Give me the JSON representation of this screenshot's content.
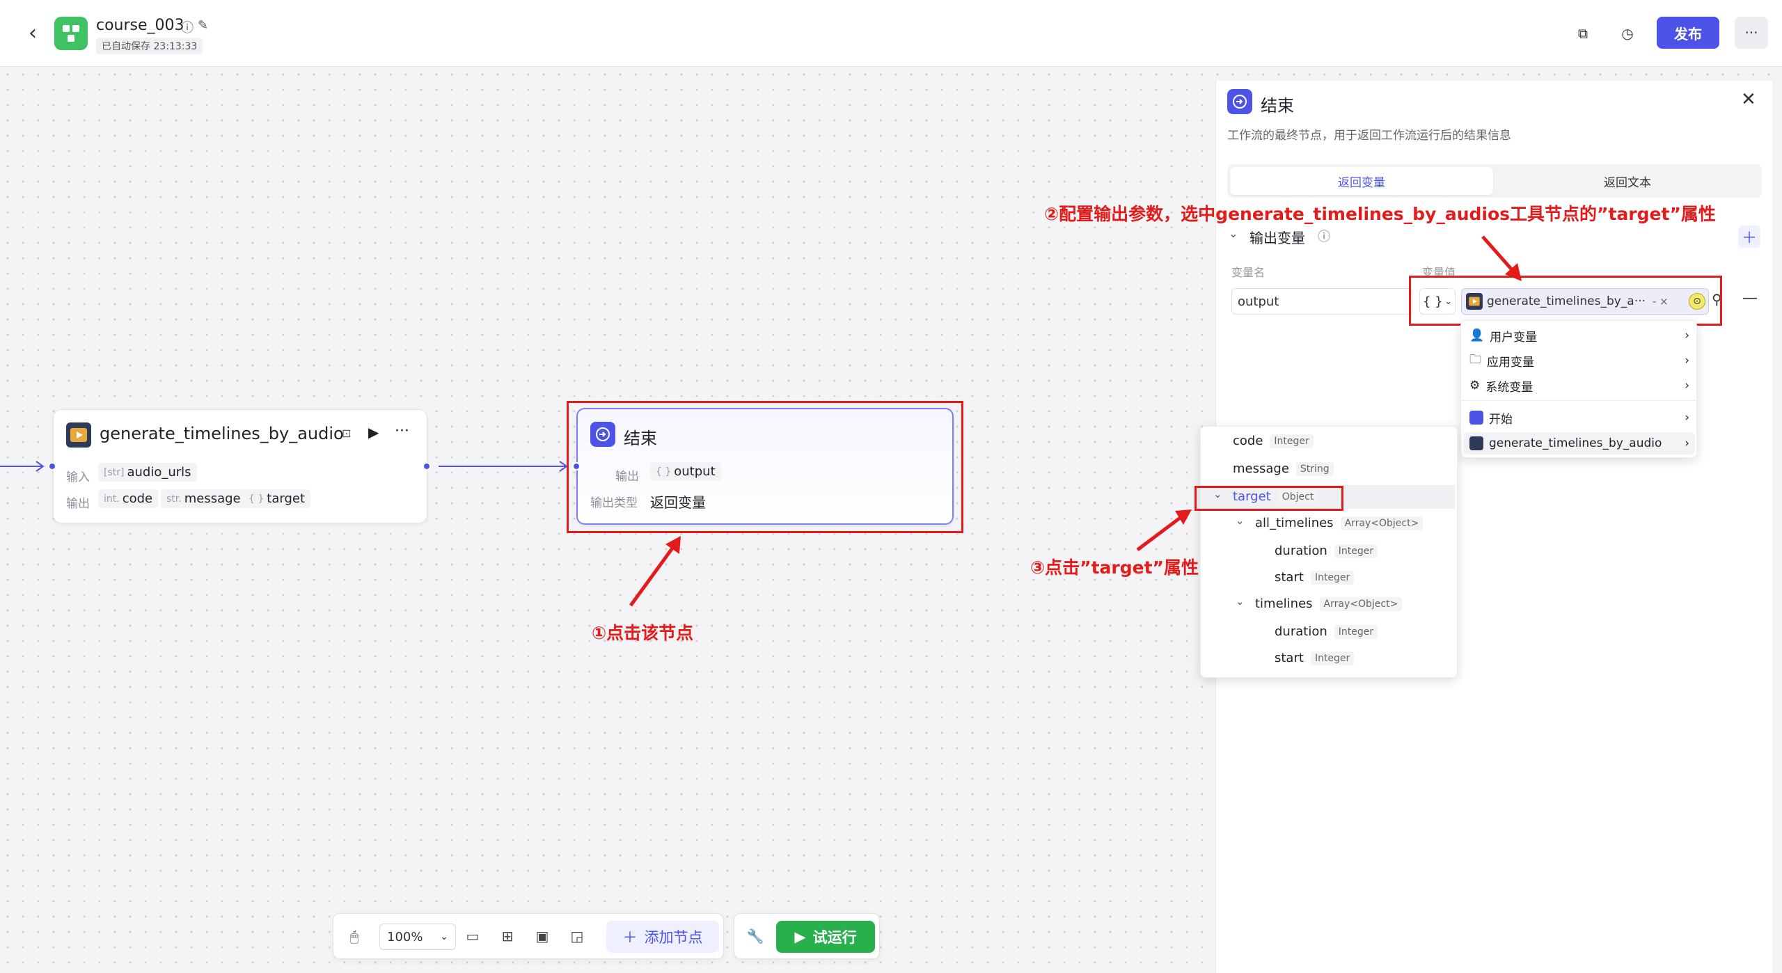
{
  "header": {
    "title": "course_003",
    "autosave": "已自动保存 23:13:33",
    "publish_label": "发布"
  },
  "nodes": {
    "gen": {
      "title": "generate_timelines_by_audio",
      "input_label": "输入",
      "input_type": "[str]",
      "input_name": "audio_urls",
      "output_label": "输出",
      "outputs": [
        {
          "type": "int.",
          "name": "code"
        },
        {
          "type": "str.",
          "name": "message"
        },
        {
          "type": "{ }",
          "name": "target"
        }
      ]
    },
    "end": {
      "title": "结束",
      "output_label": "输出",
      "output_type": "{ }",
      "output_name": "output",
      "output_kind_label": "输出类型",
      "output_kind_value": "返回变量"
    }
  },
  "annotations": {
    "a1": "①点击该节点",
    "a2": "②配置输出参数，选中generate_timelines_by_audios工具节点的”target”属性",
    "a3": "③点击”target”属性"
  },
  "toolbar": {
    "zoom": "100%",
    "add_node": "添加节点",
    "run": "试运行"
  },
  "panel": {
    "title": "结束",
    "description": "工作流的最终节点，用于返回工作流运行后的结果信息",
    "tabs": [
      "返回变量",
      "返回文本"
    ],
    "section_title": "输出变量",
    "col_name": "变量名",
    "col_value": "变量值",
    "var_name": "output",
    "type_icon": "{ }",
    "ref_text": "generate_timelines_by_a···",
    "ref_suffix": "- ×"
  },
  "var_menu": {
    "items": [
      {
        "label": "用户变量",
        "icon": "user-icon"
      },
      {
        "label": "应用变量",
        "icon": "folder-icon"
      },
      {
        "label": "系统变量",
        "icon": "gear-icon"
      },
      {
        "label": "开始",
        "icon": "start-node-icon"
      },
      {
        "label": "generate_timelines_by_audio",
        "icon": "plugin-icon"
      }
    ]
  },
  "tree": {
    "items": [
      {
        "name": "code",
        "type": "Integer"
      },
      {
        "name": "message",
        "type": "String"
      },
      {
        "name": "target",
        "type": "Object"
      },
      {
        "name": "all_timelines",
        "type": "Array<Object>"
      },
      {
        "name": "duration",
        "type": "Integer"
      },
      {
        "name": "start",
        "type": "Integer"
      },
      {
        "name": "timelines",
        "type": "Array<Object>"
      },
      {
        "name": "duration",
        "type": "Integer"
      },
      {
        "name": "start",
        "type": "Integer"
      }
    ]
  },
  "colors": {
    "accent": "#4d53e8",
    "run": "#28b04c",
    "annotation": "#e31b1b",
    "logo": "#3ec262"
  }
}
